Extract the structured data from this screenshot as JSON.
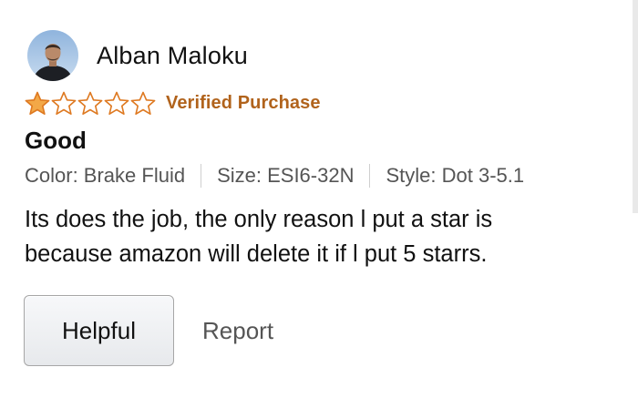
{
  "review": {
    "reviewer_name": "Alban Maloku",
    "rating": 1,
    "rating_max": 5,
    "verified_label": "Verified Purchase",
    "title": "Good",
    "variants": {
      "color": "Color: Brake Fluid",
      "size": "Size: ESI6-32N",
      "style": "Style: Dot 3-5.1"
    },
    "body_line_1": "Its does the job, the only reason l put a star is",
    "body_line_2": "because amazon will delete it if l put 5 starrs."
  },
  "actions": {
    "helpful_label": "Helpful",
    "report_label": "Report"
  },
  "colors": {
    "star_fill": "#f3a847",
    "star_outline": "#de7921",
    "verified": "#b1631c",
    "secondary_text": "#555555"
  },
  "icons": {
    "avatar": "user-photo",
    "star_filled": "star-filled-icon",
    "star_empty": "star-empty-icon"
  }
}
